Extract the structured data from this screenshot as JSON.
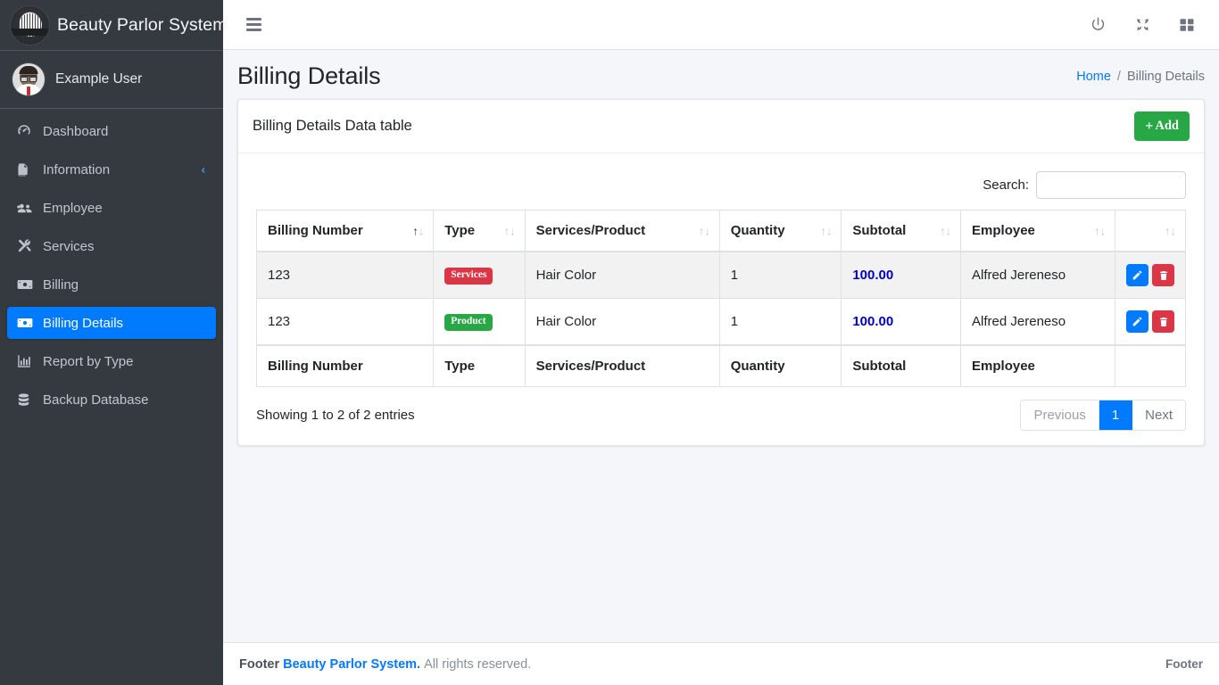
{
  "brand": {
    "title": "Beauty Parlor System",
    "logo_icon": "salon-logo-icon"
  },
  "user_panel": {
    "name": "Example User",
    "avatar_icon": "user-avatar-icon"
  },
  "sidebar": {
    "items": [
      {
        "label": "Dashboard",
        "icon": "tachometer-icon",
        "active": false,
        "has_arrow": false
      },
      {
        "label": "Information",
        "icon": "copy-files-icon",
        "active": false,
        "has_arrow": true
      },
      {
        "label": "Employee",
        "icon": "users-icon",
        "active": false,
        "has_arrow": false
      },
      {
        "label": "Services",
        "icon": "tools-icon",
        "active": false,
        "has_arrow": false
      },
      {
        "label": "Billing",
        "icon": "money-bill-icon",
        "active": false,
        "has_arrow": false
      },
      {
        "label": "Billing Details",
        "icon": "money-bill-icon",
        "active": true,
        "has_arrow": false
      },
      {
        "label": "Report by Type",
        "icon": "chart-bar-icon",
        "active": false,
        "has_arrow": false
      },
      {
        "label": "Backup Database",
        "icon": "database-icon",
        "active": false,
        "has_arrow": false
      }
    ],
    "collapse_arrow": "‹"
  },
  "navbar": {
    "menu_icon": "hamburger-menu-icon",
    "actions": [
      {
        "icon": "power-off-icon"
      },
      {
        "icon": "compress-arrows-icon"
      },
      {
        "icon": "th-large-grid-icon"
      }
    ]
  },
  "header": {
    "title": "Billing Details",
    "breadcrumb": {
      "home": "Home",
      "separator": "/",
      "current": "Billing Details"
    }
  },
  "card": {
    "title": "Billing Details Data table",
    "add_button": {
      "label": "Add",
      "icon": "plus-icon"
    }
  },
  "search": {
    "label": "Search:",
    "value": "",
    "placeholder": ""
  },
  "table": {
    "columns": [
      {
        "label": "Billing Number",
        "sorted": "asc"
      },
      {
        "label": "Type",
        "sorted": "none"
      },
      {
        "label": "Services/Product",
        "sorted": "none"
      },
      {
        "label": "Quantity",
        "sorted": "none"
      },
      {
        "label": "Subtotal",
        "sorted": "none"
      },
      {
        "label": "Employee",
        "sorted": "none"
      },
      {
        "label": "",
        "sorted": "none"
      }
    ],
    "rows": [
      {
        "billing_number": "123",
        "type": "Services",
        "type_style": "services",
        "service_product": "Hair Color",
        "quantity": "1",
        "subtotal": "100.00",
        "employee": "Alfred Jereneso",
        "edit_icon": "pencil-icon",
        "delete_icon": "trash-icon"
      },
      {
        "billing_number": "123",
        "type": "Product",
        "type_style": "product",
        "service_product": "Hair Color",
        "quantity": "1",
        "subtotal": "100.00",
        "employee": "Alfred Jereneso",
        "edit_icon": "pencil-icon",
        "delete_icon": "trash-icon"
      }
    ],
    "footer_columns": [
      "Billing Number",
      "Type",
      "Services/Product",
      "Quantity",
      "Subtotal",
      "Employee",
      ""
    ],
    "info": "Showing 1 to 2 of 2 entries",
    "pagination": {
      "previous": "Previous",
      "pages": [
        "1"
      ],
      "next": "Next",
      "current": "1"
    }
  },
  "footer": {
    "prefix": "Footer",
    "brand": "Beauty Parlor System.",
    "rights": "All rights reserved.",
    "right_text": "Footer"
  },
  "colors": {
    "sidebar_bg": "#343a40",
    "accent_blue": "#007bff",
    "success_green": "#28a745",
    "danger_red": "#dc3545",
    "subtotal_blue": "#0000cd",
    "content_bg": "#f4f6f9"
  }
}
